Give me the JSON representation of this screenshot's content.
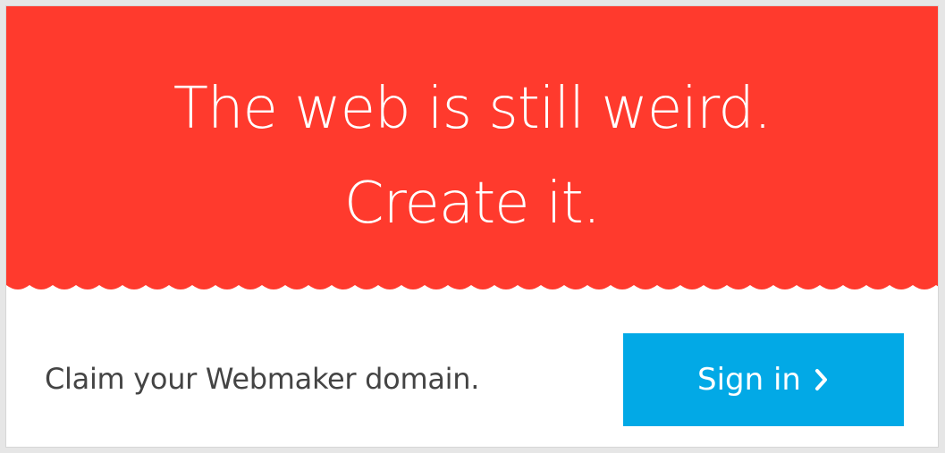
{
  "hero": {
    "line1": "The web is still weird.",
    "line2": "Create it."
  },
  "footer": {
    "claim_text": "Claim your Webmaker domain.",
    "signin_label": "Sign in",
    "signin_icon": "chevron-right-icon"
  },
  "colors": {
    "hero_bg": "#ff3a2d",
    "button_bg": "#02a9e6",
    "text_dark": "#444444"
  }
}
